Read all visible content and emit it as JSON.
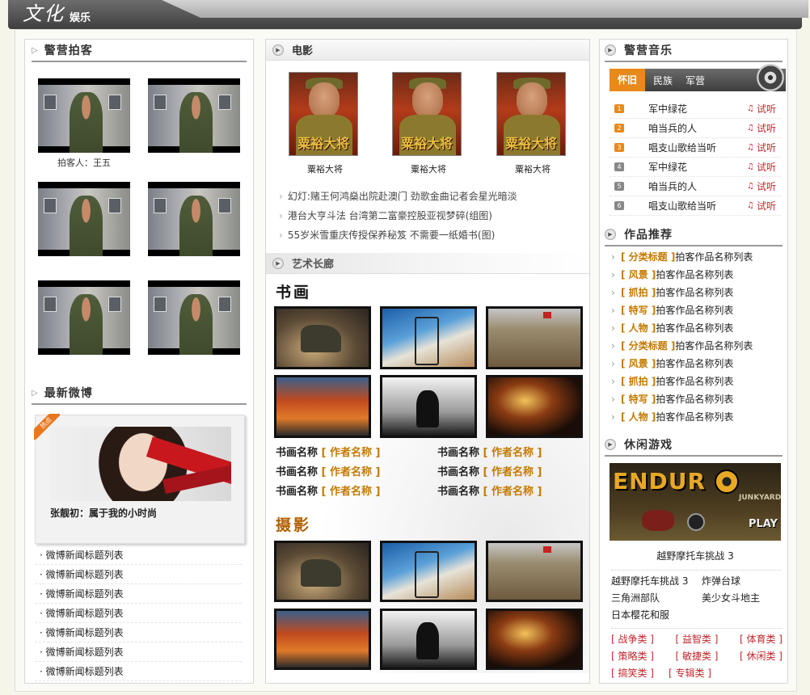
{
  "banner": {
    "logo_big": "文化",
    "logo_small": "娱乐"
  },
  "left": {
    "paike": {
      "title": "警营拍客",
      "caption": "拍客人：王五"
    },
    "weibo": {
      "title": "最新微博",
      "badge": "热点",
      "feature_caption": "张靓初：属于我的小时尚",
      "items": [
        "微博新闻标题列表",
        "微博新闻标题列表",
        "微博新闻标题列表",
        "微博新闻标题列表",
        "微博新闻标题列表",
        "微博新闻标题列表",
        "微博新闻标题列表"
      ]
    }
  },
  "mid": {
    "movie": {
      "title": "电影",
      "posters": [
        {
          "caption": "粟裕大将",
          "text": "粟裕大将"
        },
        {
          "caption": "粟裕大将",
          "text": "粟裕大将"
        },
        {
          "caption": "粟裕大将",
          "text": "粟裕大将"
        }
      ],
      "news": [
        "幻灯:赌王何鸿燊出院赴澳门  劲歌金曲记者会星光暗淡",
        "港台大亨斗法  台湾第二富豪控股亚视梦碎(组图)",
        "55岁米雪重庆传授保养秘笈  不需要一纸婚书(图)"
      ]
    },
    "art": {
      "title": "艺术长廊",
      "calligraphy": "书画",
      "photo": "摄影",
      "works": [
        {
          "name": "书画名称",
          "author": "[ 作者名称 ]"
        },
        {
          "name": "书画名称",
          "author": "[ 作者名称 ]"
        },
        {
          "name": "书画名称",
          "author": "[ 作者名称 ]"
        },
        {
          "name": "书画名称",
          "author": "[ 作者名称 ]"
        },
        {
          "name": "书画名称",
          "author": "[ 作者名称 ]"
        },
        {
          "name": "书画名称",
          "author": "[ 作者名称 ]"
        }
      ]
    }
  },
  "right": {
    "music": {
      "title": "警营音乐",
      "tabs": [
        "怀旧",
        "民族",
        "军营"
      ],
      "listen_label": "试听",
      "items": [
        {
          "num": "1",
          "title": "军中绿花"
        },
        {
          "num": "2",
          "title": "咱当兵的人"
        },
        {
          "num": "3",
          "title": "唱支山歌给当听"
        },
        {
          "num": "4",
          "title": "军中绿花"
        },
        {
          "num": "5",
          "title": "咱当兵的人"
        },
        {
          "num": "6",
          "title": "唱支山歌给当听"
        }
      ],
      "colors": {
        "hot": "#e88a1a",
        "normal": "#888888",
        "accent": "#c0282d"
      }
    },
    "works": {
      "title": "作品推荐",
      "items": [
        {
          "tag": "[ 分类标题 ]",
          "text": "拍客作品名称列表"
        },
        {
          "tag": "[ 风景 ]",
          "text": "拍客作品名称列表"
        },
        {
          "tag": "[ 抓拍 ]",
          "text": "拍客作品名称列表"
        },
        {
          "tag": "[ 特写 ]",
          "text": "拍客作品名称列表"
        },
        {
          "tag": "[ 人物 ]",
          "text": "拍客作品名称列表"
        },
        {
          "tag": "[ 分类标题 ]",
          "text": "拍客作品名称列表"
        },
        {
          "tag": "[ 风景 ]",
          "text": "拍客作品名称列表"
        },
        {
          "tag": "[ 抓拍 ]",
          "text": "拍客作品名称列表"
        },
        {
          "tag": "[ 特写 ]",
          "text": "拍客作品名称列表"
        },
        {
          "tag": "[ 人物 ]",
          "text": "拍客作品名称列表"
        }
      ]
    },
    "games": {
      "title": "休闲游戏",
      "banner_text": "ENDUR",
      "banner_sub": "JUNKYARD",
      "banner_play": "PLAY",
      "feature_caption": "越野摩托车挑战 3",
      "links": [
        "越野摩托车挑战 3",
        "炸弹台球",
        "三角洲部队",
        "美少女斗地主",
        "日本樱花和服"
      ],
      "categories": [
        "[ 战争类 ]",
        "[ 益智类 ]",
        "[ 体育类 ]",
        "[ 策略类 ]",
        "[ 敏捷类 ]",
        "[ 休闲类 ]",
        "[ 搞笑类 ]",
        "[ 专辑类 ]"
      ]
    }
  }
}
